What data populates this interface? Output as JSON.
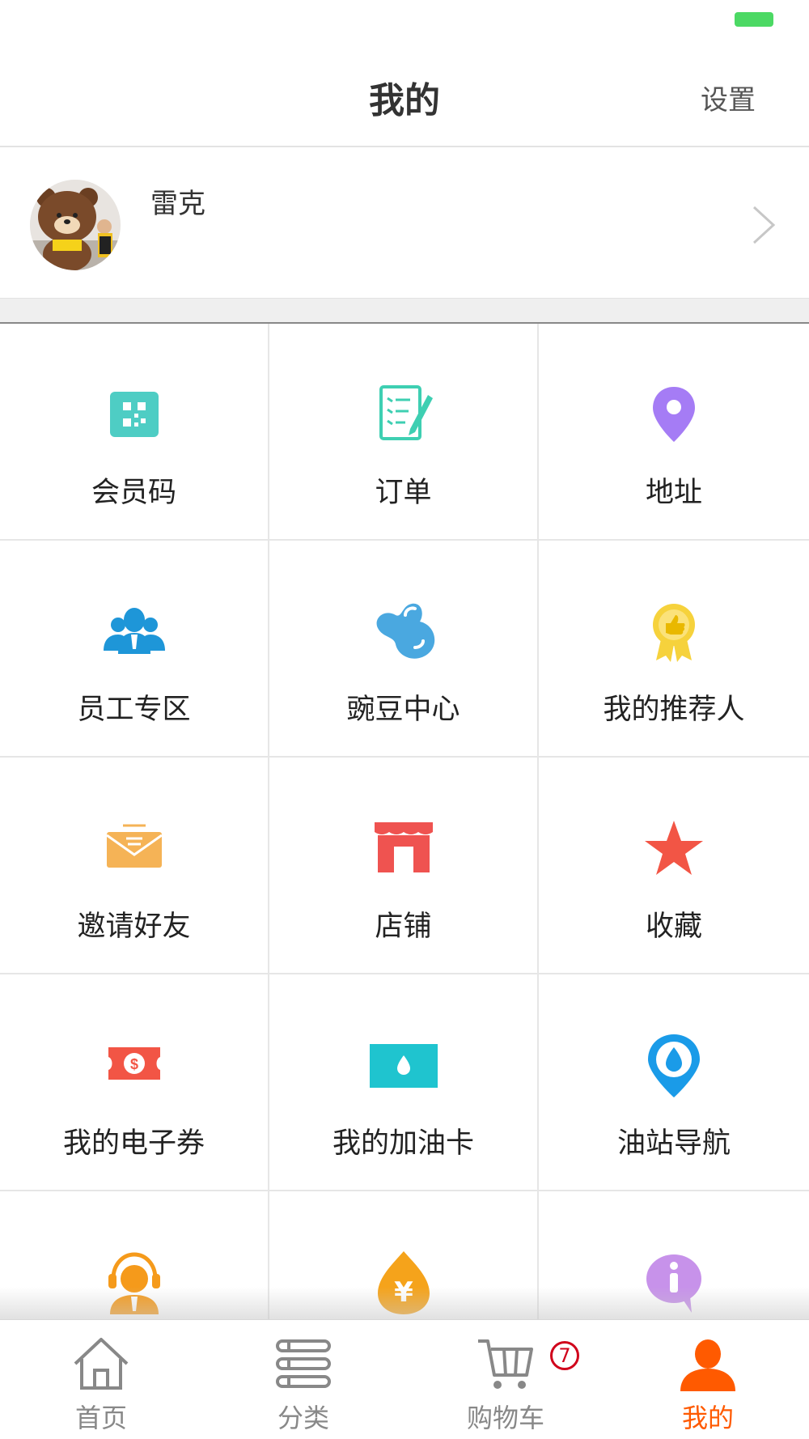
{
  "status_bar": {
    "battery_color": "#4cd964"
  },
  "header": {
    "title": "我的",
    "settings_label": "设置"
  },
  "profile": {
    "username": "雷克",
    "avatar_icon": "bear-mascot-avatar"
  },
  "menu": {
    "items": [
      {
        "label": "会员码",
        "icon": "qr-code-icon",
        "color": "#4ecdc4"
      },
      {
        "label": "订单",
        "icon": "order-list-icon",
        "color": "#3ecfb2"
      },
      {
        "label": "地址",
        "icon": "location-pin-icon",
        "color": "#a57cf5"
      },
      {
        "label": "员工专区",
        "icon": "staff-group-icon",
        "color": "#1e96d8"
      },
      {
        "label": "豌豆中心",
        "icon": "pea-icon",
        "color": "#4aa8e0"
      },
      {
        "label": "我的推荐人",
        "icon": "award-badge-icon",
        "color": "#f6d23c"
      },
      {
        "label": "邀请好友",
        "icon": "envelope-icon",
        "color": "#f5b356"
      },
      {
        "label": "店铺",
        "icon": "store-icon",
        "color": "#ef5350"
      },
      {
        "label": "收藏",
        "icon": "star-icon",
        "color": "#f25545"
      },
      {
        "label": "我的电子券",
        "icon": "coupon-icon",
        "color": "#f25545"
      },
      {
        "label": "我的加油卡",
        "icon": "fuel-card-icon",
        "color": "#1fc4cf"
      },
      {
        "label": "油站导航",
        "icon": "fuel-station-pin-icon",
        "color": "#1a9be8"
      },
      {
        "label": "",
        "icon": "customer-service-icon",
        "color": "#f59a1b"
      },
      {
        "label": "",
        "icon": "money-bag-icon",
        "color": "#f5a31b"
      },
      {
        "label": "",
        "icon": "info-bubble-icon",
        "color": "#c792ea"
      }
    ]
  },
  "tabbar": {
    "tabs": [
      {
        "label": "首页",
        "icon": "home-icon"
      },
      {
        "label": "分类",
        "icon": "category-list-icon"
      },
      {
        "label": "购物车",
        "icon": "cart-icon",
        "badge": "7"
      },
      {
        "label": "我的",
        "icon": "user-icon"
      }
    ],
    "active_color": "#ff5a00",
    "inactive_color": "#888888"
  }
}
